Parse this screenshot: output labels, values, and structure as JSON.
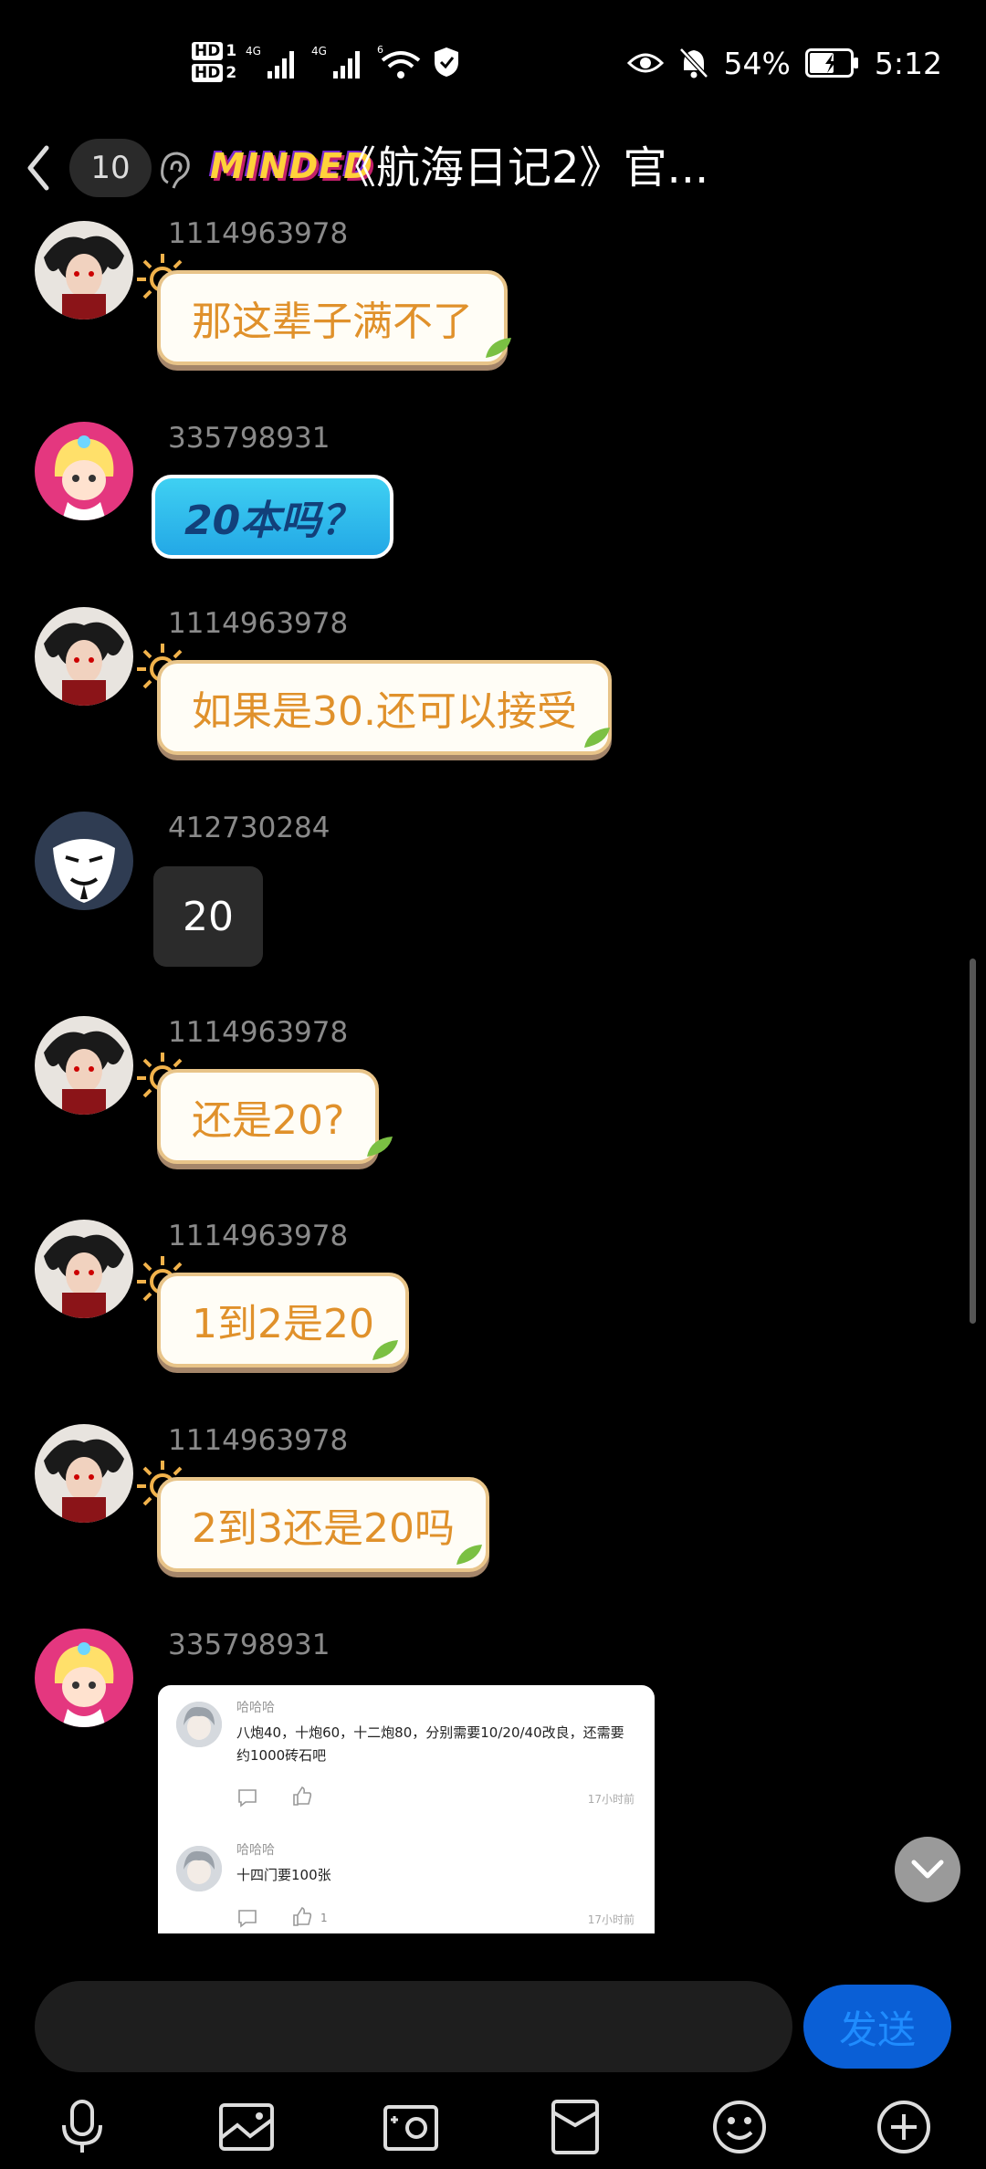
{
  "status_bar": {
    "hd1": "HD",
    "hd1_num": "1",
    "hd2": "HD",
    "hd2_num": "2",
    "net1": "4G",
    "net2": "4G",
    "wifi_gen": "6",
    "battery": "54%",
    "time": "5:12"
  },
  "header": {
    "member_count": "10",
    "logo_text": "MINDED",
    "title": "《航海日记2》官..."
  },
  "messages": [
    {
      "sender": "1114963978",
      "text": "那这辈子满不了",
      "style": "sun-bubble"
    },
    {
      "sender": "335798931",
      "text": "20本吗？",
      "style": "blue-bubble"
    },
    {
      "sender": "1114963978",
      "text": "如果是30.还可以接受",
      "style": "sun-bubble"
    },
    {
      "sender": "412730284",
      "text": "20",
      "style": "plain-bubble"
    },
    {
      "sender": "1114963978",
      "text": "还是20?",
      "style": "sun-bubble"
    },
    {
      "sender": "1114963978",
      "text": "1到2是20",
      "style": "sun-bubble"
    },
    {
      "sender": "1114963978",
      "text": "2到3还是20吗",
      "style": "sun-bubble"
    },
    {
      "sender": "335798931",
      "style": "image"
    }
  ],
  "image_card": {
    "comments": [
      {
        "name": "哈哈哈",
        "text": "八炮40，十炮60，十二炮80，分别需要10/20/40改良，还需要约1000砖石吧",
        "time": "17小时前",
        "likes": ""
      },
      {
        "name": "哈哈哈",
        "text": "十四门要100张",
        "time": "17小时前",
        "likes": "1"
      }
    ]
  },
  "composer": {
    "input_value": "",
    "send_label": "发送"
  },
  "colors": {
    "background": "#000000",
    "sun_text": "#e0912b",
    "send_button": "#0a5fd6",
    "sender_name": "#8a8a8a"
  },
  "icons": [
    "back-icon",
    "ear-icon",
    "eye-icon",
    "mute-bell-icon",
    "battery-icon",
    "microphone-icon",
    "image-icon",
    "camera-icon",
    "red-packet-icon",
    "emoji-icon",
    "plus-icon",
    "chevron-down-icon"
  ]
}
